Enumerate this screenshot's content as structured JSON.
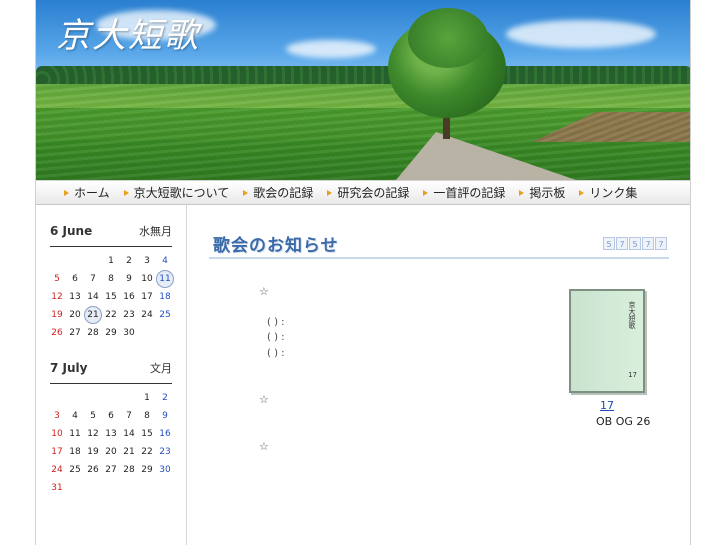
{
  "header": {
    "logo_text": "京大短歌"
  },
  "nav": {
    "items": [
      {
        "label": "ホーム"
      },
      {
        "label": "京大短歌について"
      },
      {
        "label": "歌会の記録"
      },
      {
        "label": "研究会の記録"
      },
      {
        "label": "一首評の記録"
      },
      {
        "label": "掲示板"
      },
      {
        "label": "リンク集"
      }
    ],
    "arrow_color": "#e8a020"
  },
  "sidebar": {
    "june": {
      "name": "6 June",
      "alt": "水無月",
      "days": [
        "",
        "",
        "",
        "1",
        "2",
        "3",
        "4",
        "5",
        "6",
        "7",
        "8",
        "9",
        "10",
        "11",
        "12",
        "13",
        "14",
        "15",
        "16",
        "17",
        "18",
        "19",
        "20",
        "21",
        "22",
        "23",
        "24",
        "25",
        "26",
        "27",
        "28",
        "29",
        "30",
        "",
        ""
      ],
      "marked": [
        "11",
        "21"
      ]
    },
    "july": {
      "name": "7 July",
      "alt": "文月",
      "days": [
        "",
        "",
        "",
        "",
        "",
        "1",
        "2",
        "3",
        "4",
        "5",
        "6",
        "7",
        "8",
        "9",
        "10",
        "11",
        "12",
        "13",
        "14",
        "15",
        "16",
        "17",
        "18",
        "19",
        "20",
        "21",
        "22",
        "23",
        "24",
        "25",
        "26",
        "27",
        "28",
        "29",
        "30",
        "31",
        "",
        "",
        "",
        "",
        "",
        ""
      ],
      "marked": []
    },
    "colors": {
      "sunday": "#d02020",
      "saturday": "#2050c0"
    }
  },
  "main": {
    "title": "歌会のお知らせ",
    "deco_digits": [
      "5",
      "7",
      "5",
      "7",
      "7"
    ],
    "stars": [
      "☆",
      "☆",
      "☆"
    ],
    "paren_lines": [
      "( ) :",
      "( ) :",
      "( ) :"
    ],
    "book": {
      "spine_title": "京大短歌",
      "spine_number": "17",
      "link_text": "17",
      "caption": "OB OG 26"
    }
  }
}
